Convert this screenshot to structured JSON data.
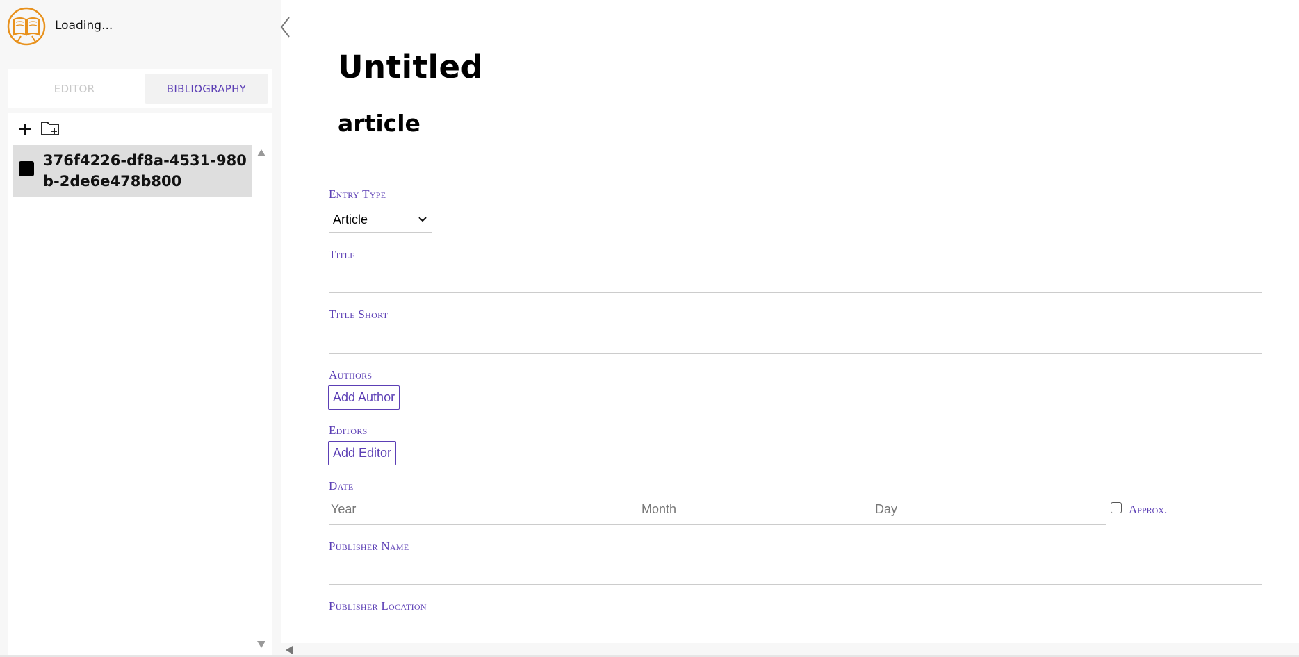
{
  "header": {
    "loading_text": "Loading..."
  },
  "sidebar": {
    "tabs": [
      {
        "label": "EDITOR",
        "active": false
      },
      {
        "label": "BIBLIOGRAPHY",
        "active": true
      }
    ],
    "toolbar": {
      "add_icon": "plus-icon",
      "new_folder_icon": "folder-plus-icon"
    },
    "items": [
      {
        "label": "376f4226-df8a-4531-980b-2de6e478b800"
      }
    ]
  },
  "main": {
    "title": "Untitled",
    "subtitle": "article",
    "form": {
      "entry_type_label": "Entry Type",
      "entry_type_value": "Article",
      "title_label": "Title",
      "title_short_label": "Title Short",
      "authors_label": "Authors",
      "add_author_button": "Add Author",
      "editors_label": "Editors",
      "add_editor_button": "Add Editor",
      "date_label": "Date",
      "year_placeholder": "Year",
      "month_placeholder": "Month",
      "day_placeholder": "Day",
      "approx_label": "Approx.",
      "publisher_name_label": "Publisher Name",
      "publisher_location_label": "Publisher Location"
    }
  },
  "colors": {
    "accent": "#5c3fb5",
    "logo": "#e8911c",
    "sidebar_bg": "#f7f7f7",
    "selected_item_bg": "#dedede"
  }
}
